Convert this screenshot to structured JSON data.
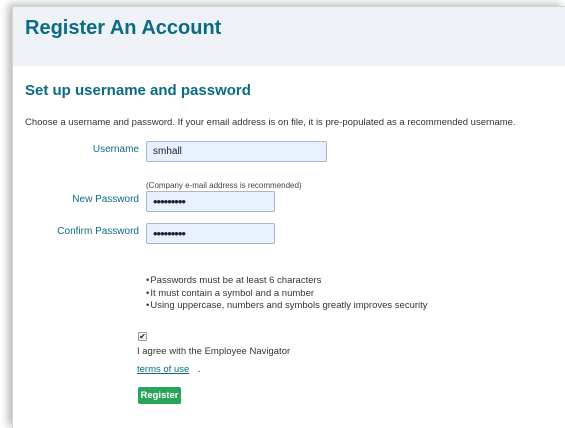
{
  "header": {
    "title": "Register An Account"
  },
  "section": {
    "title": "Set up username and password",
    "intro": "Choose a username and password. If your email address is on file, it is pre-populated as a recommended username."
  },
  "form": {
    "username_label": "Username",
    "username_value": "smhall",
    "username_hint": "(Company e-mail address is recommended)",
    "new_password_label": "New Password",
    "new_password_value": "•••••••••",
    "confirm_password_label": "Confirm Password",
    "confirm_password_value": "•••••••••"
  },
  "password_rules": [
    "Passwords must be at least 6 characters",
    "It must contain a symbol and a number",
    "Using uppercase, numbers and symbols greatly improves security"
  ],
  "agreement": {
    "checked": true,
    "text": "I agree with the Employee Navigator",
    "link": "terms of use",
    "suffix": "."
  },
  "actions": {
    "register_label": "Register"
  },
  "colors": {
    "accent": "#0b6b84",
    "header_bg": "#eef1f5",
    "button": "#28a55a",
    "input_bg": "#e8f0fe"
  }
}
